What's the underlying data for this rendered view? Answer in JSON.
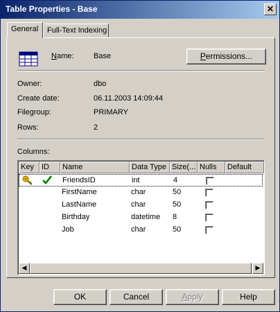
{
  "window": {
    "title": "Table Properties - Base",
    "close_glyph": "✕"
  },
  "tabs": [
    {
      "label": "General",
      "active": true
    },
    {
      "label": "Full-Text Indexing",
      "active": false
    }
  ],
  "general": {
    "name_label_u": "N",
    "name_label_rest": "ame:",
    "name_value": "Base",
    "permissions_u": "P",
    "permissions_rest": "ermissions...",
    "owner_label": "Owner:",
    "owner_value": "dbo",
    "create_date_label": "Create date:",
    "create_date_value": "06.11.2003 14:09:44",
    "filegroup_label": "Filegroup:",
    "filegroup_value": "PRIMARY",
    "rows_label": "Rows:",
    "rows_value": "2",
    "columns_label": "Columns:"
  },
  "columns_table": {
    "headers": [
      "Key",
      "ID",
      "Name",
      "Data Type",
      "Size(...",
      "Nulls",
      "Default"
    ],
    "rows": [
      {
        "key": "key-icon",
        "id": "checkmark-icon",
        "name": "FriendsID",
        "data_type": "int",
        "size": "4",
        "nulls": false,
        "default": ""
      },
      {
        "key": "",
        "id": "",
        "name": "FirstName",
        "data_type": "char",
        "size": "50",
        "nulls": false,
        "default": ""
      },
      {
        "key": "",
        "id": "",
        "name": "LastName",
        "data_type": "char",
        "size": "50",
        "nulls": false,
        "default": ""
      },
      {
        "key": "",
        "id": "",
        "name": "Birthday",
        "data_type": "datetime",
        "size": "8",
        "nulls": false,
        "default": ""
      },
      {
        "key": "",
        "id": "",
        "name": "Job",
        "data_type": "char",
        "size": "50",
        "nulls": false,
        "default": ""
      }
    ]
  },
  "scrollbar": {
    "left_glyph": "◀",
    "right_glyph": "▶"
  },
  "buttons": {
    "ok": "OK",
    "cancel": "Cancel",
    "apply_u": "A",
    "apply_rest": "pply",
    "help": "Help"
  },
  "colors": {
    "title_gradient_start": "#0a246a",
    "title_gradient_end": "#a6caf0",
    "face": "#d4d0c8"
  }
}
